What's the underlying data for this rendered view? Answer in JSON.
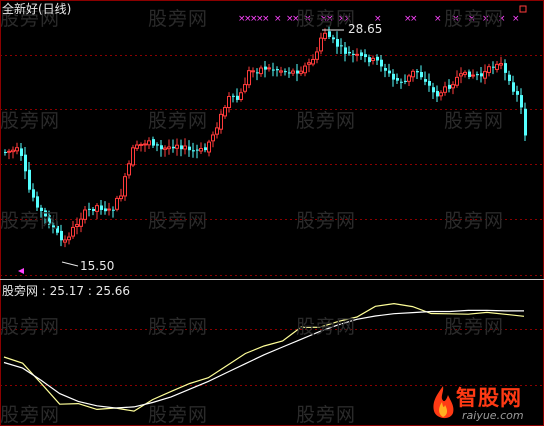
{
  "upper_panel": {
    "title": "全新好(日线)",
    "high_price_label": "28.65",
    "low_price_label": "15.50"
  },
  "lower_panel": {
    "indicator_label": "股旁网 : 25.17 : 25.66"
  },
  "watermark": {
    "text": "股旁网"
  },
  "logo": {
    "name": "智股网",
    "url": "raiyue.com"
  },
  "colors": {
    "up_candle": "#ff3b3b",
    "down_candle": "#55ffff",
    "signal_marker": "#ff44ff",
    "line_main": "#ffff99",
    "line_slow": "#ffffff",
    "grid": "#8b0000",
    "logo_accent": "#ff3a14"
  },
  "chart_data": [
    {
      "type": "candlestick",
      "title": "全新好(日线)",
      "annotations": [
        "28.65",
        "15.50"
      ],
      "y_high": 28.65,
      "y_low": 15.5
    },
    {
      "type": "line",
      "series": [
        {
          "values": [
            21.5,
            20.8,
            18.9,
            17.6,
            17.2,
            16.9,
            16.7,
            17.0,
            17.6,
            18.3,
            19.1,
            20.0,
            20.9,
            21.7,
            22.6,
            23.1,
            23.8,
            24.5,
            24.9,
            25.4,
            25.8,
            26.1,
            25.9,
            25.7,
            25.5,
            25.6,
            25.4,
            25.2,
            25.17
          ]
        },
        {
          "values": [
            21.0,
            20.5,
            19.4,
            18.2,
            17.5,
            17.1,
            16.9,
            17.0,
            17.4,
            17.9,
            18.6,
            19.3,
            20.1,
            20.9,
            21.7,
            22.4,
            23.1,
            23.8,
            24.4,
            24.9,
            25.2,
            25.4,
            25.5,
            25.6,
            25.6,
            25.7,
            25.7,
            25.66,
            25.66
          ]
        }
      ]
    }
  ]
}
